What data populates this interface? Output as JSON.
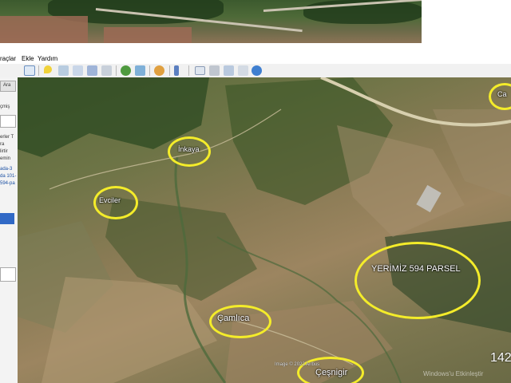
{
  "menu": {
    "items": [
      "raçlar",
      "Ekle",
      "Yardım"
    ]
  },
  "toolbar": {
    "icons": [
      "sidebar-toggle-icon",
      "placemark-icon",
      "polygon-icon",
      "path-icon",
      "image-overlay-icon",
      "tour-record-icon",
      "historical-imagery-icon",
      "sunlight-icon",
      "planets-icon",
      "ruler-icon",
      "email-icon",
      "print-icon",
      "save-image-icon",
      "view-in-maps-icon",
      "web-icon"
    ]
  },
  "sidebar": {
    "search_button": "Ara",
    "history_label": "çmiş",
    "items": [
      "erler T",
      "ra",
      "lirtir",
      "emin",
      "ada-3",
      "da 101-",
      "594-pa"
    ]
  },
  "map": {
    "labels": {
      "inkaya": "İnkaya",
      "eviler": "Evciler",
      "yerimiz": "YERİMİZ 594 PARSEL",
      "camlica": "Çamlıca",
      "cesnigir": "Çeşnigir",
      "corner": "Ca"
    },
    "credit": "Image © 2022 Airbus",
    "zoom_text": "142",
    "watermark": "Windows'u Etkinleştir"
  },
  "colors": {
    "highlight": "#f4ec2a",
    "toolbar_bg": "#f1f1f1"
  }
}
